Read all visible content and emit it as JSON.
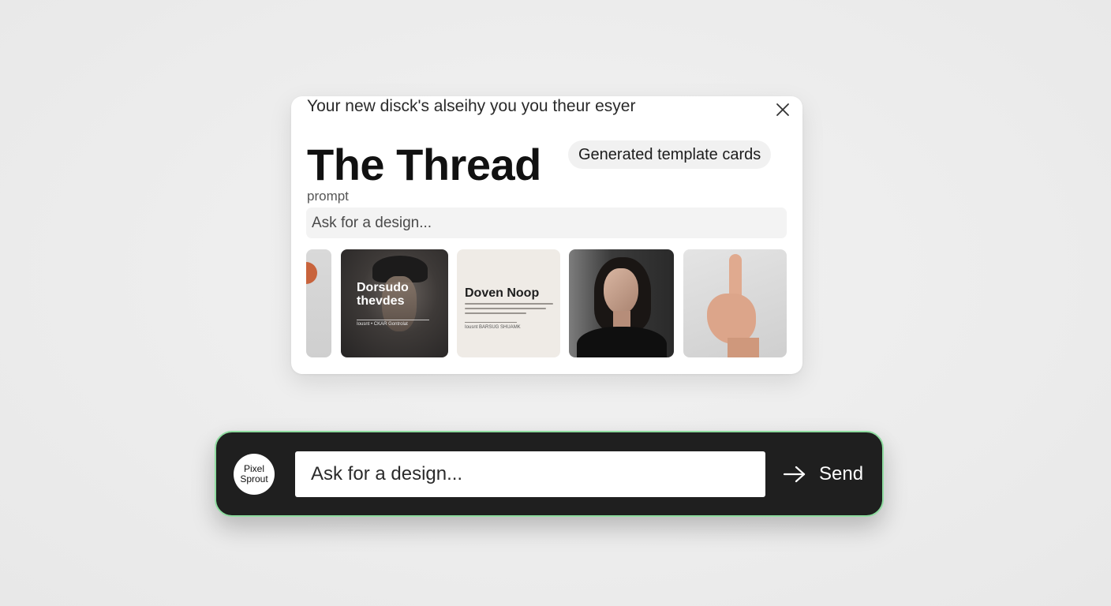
{
  "popup": {
    "tagline": "Your new disck's alseihy you you theur esyer",
    "title": "The Thread",
    "chip_label": "Generated template cards",
    "prompt_label": "prompt",
    "input_placeholder": "Ask for a design...",
    "tiles": [
      {
        "kind": "partial-tile"
      },
      {
        "heading": "Dorsudo\nthevdes",
        "subtext": "Iousnt • CKAR Gontrolat"
      },
      {
        "heading": "Doven Noop",
        "subtext": "Iousnt BARSUG SHUAMK"
      },
      {
        "kind": "portrait-photo"
      },
      {
        "kind": "hand-photo"
      }
    ]
  },
  "composer": {
    "avatar_text": "Pixel\nSprout",
    "input_placeholder": "Ask for a design...",
    "send_label": "Send",
    "border_color": "#8fdca0"
  }
}
